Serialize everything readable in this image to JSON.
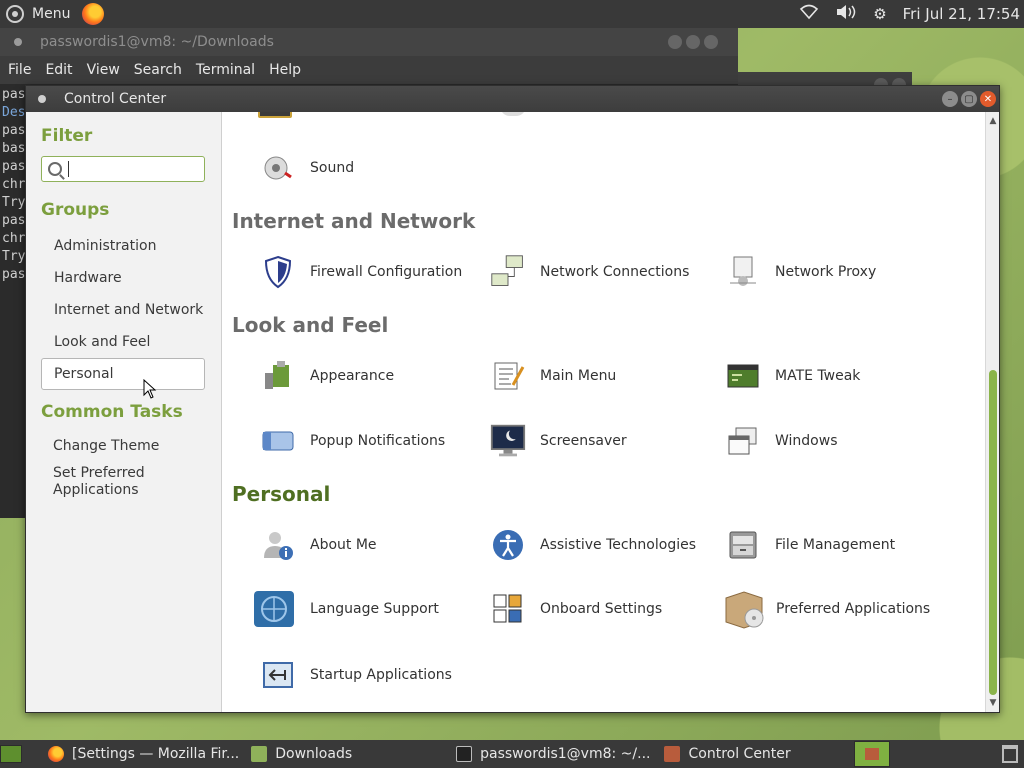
{
  "top_panel": {
    "menu_label": "Menu",
    "clock": "Fri Jul 21, 17:54",
    "tray_icons": [
      "wifi-icon",
      "volume-icon",
      "settings-gear-icon"
    ]
  },
  "terminal": {
    "title": "passwordis1@vm8: ~/Downloads",
    "menu": [
      "File",
      "Edit",
      "View",
      "Search",
      "Terminal",
      "Help"
    ],
    "lines": [
      "pas",
      "Des",
      "pas",
      "bas",
      "pas",
      "chr",
      "Try",
      "pas",
      "chr",
      "Try",
      "pas"
    ]
  },
  "control_center": {
    "title": "Control Center",
    "sidebar": {
      "filter_heading": "Filter",
      "search_value": "",
      "groups_heading": "Groups",
      "groups": [
        "Administration",
        "Hardware",
        "Internet and Network",
        "Look and Feel",
        "Personal"
      ],
      "selected_group": "Personal",
      "common_tasks_heading": "Common Tasks",
      "tasks": [
        "Change Theme",
        "Set Preferred Applications"
      ]
    },
    "sections": [
      {
        "title": "",
        "items": [
          {
            "label": "Sound",
            "icon": "sound-icon"
          }
        ]
      },
      {
        "title": "Internet and Network",
        "items": [
          {
            "label": "Firewall Configuration",
            "icon": "shield-icon"
          },
          {
            "label": "Network Connections",
            "icon": "network-icon"
          },
          {
            "label": "Network Proxy",
            "icon": "proxy-icon"
          }
        ]
      },
      {
        "title": "Look and Feel",
        "items": [
          {
            "label": "Appearance",
            "icon": "appearance-icon"
          },
          {
            "label": "Main Menu",
            "icon": "main-menu-icon"
          },
          {
            "label": "MATE Tweak",
            "icon": "tweak-icon"
          },
          {
            "label": "Popup Notifications",
            "icon": "notification-icon"
          },
          {
            "label": "Screensaver",
            "icon": "screensaver-icon"
          },
          {
            "label": "Windows",
            "icon": "windows-icon"
          }
        ]
      },
      {
        "title": "Personal",
        "items": [
          {
            "label": "About Me",
            "icon": "about-me-icon"
          },
          {
            "label": "Assistive Technologies",
            "icon": "accessibility-icon"
          },
          {
            "label": "File Management",
            "icon": "file-cabinet-icon"
          },
          {
            "label": "Language Support",
            "icon": "globe-icon"
          },
          {
            "label": "Onboard Settings",
            "icon": "keyboard-icon"
          },
          {
            "label": "Preferred Applications",
            "icon": "box-icon"
          },
          {
            "label": "Startup Applications",
            "icon": "startup-icon"
          }
        ]
      }
    ]
  },
  "taskbar": {
    "tasks": [
      {
        "label": "[Settings — Mozilla Fir...",
        "icon": "firefox-icon"
      },
      {
        "label": "Downloads",
        "icon": "folder-icon"
      },
      {
        "label": "passwordis1@vm8: ~/...",
        "icon": "terminal-icon"
      },
      {
        "label": "Control Center",
        "icon": "control-center-icon"
      }
    ]
  },
  "colors": {
    "accent_green": "#7c9f3e",
    "section_personal": "#4f6f22",
    "panel": "#393939",
    "close_button": "#e25b2c"
  }
}
